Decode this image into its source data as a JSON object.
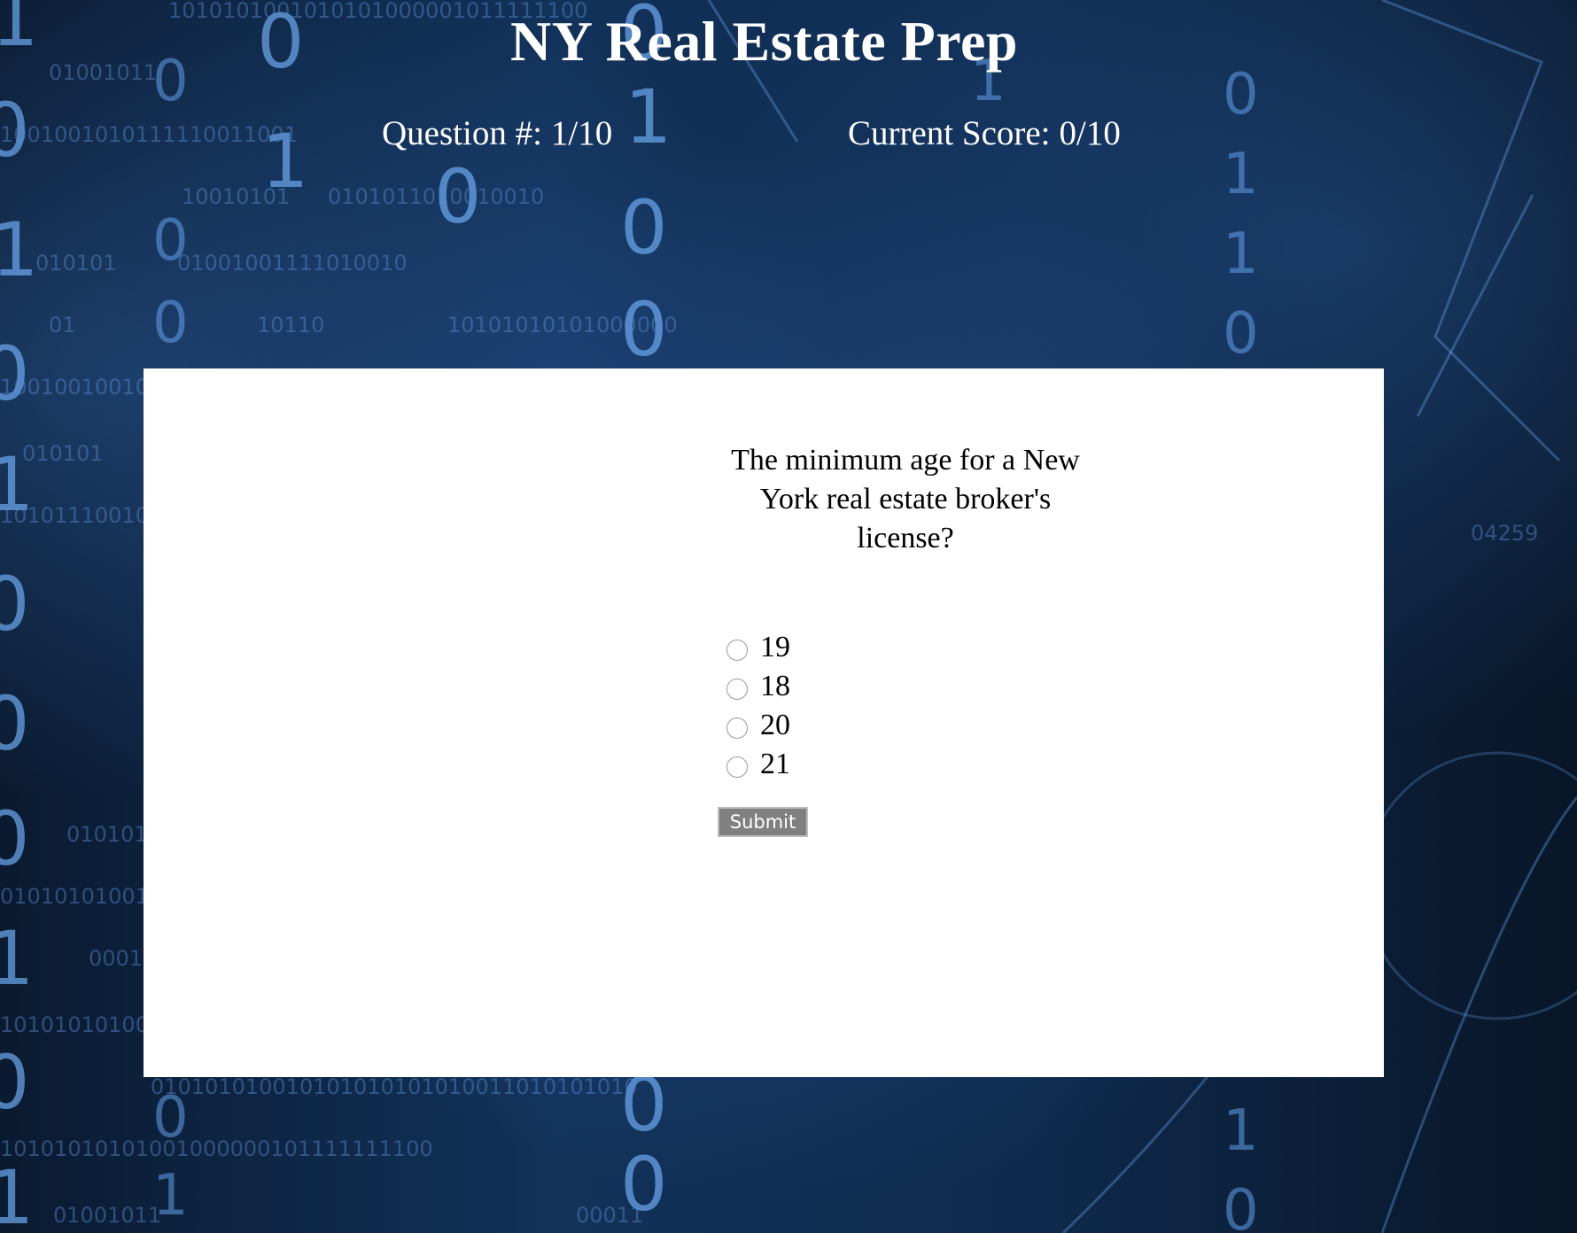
{
  "app": {
    "title": "NY Real Estate Prep"
  },
  "status": {
    "question_label": "Question #:",
    "question_value": "1/10",
    "score_label": "Current Score:",
    "score_value": "0/10"
  },
  "quiz": {
    "question": "The minimum age for a New York real estate broker's license?",
    "answers": [
      {
        "label": "19",
        "selected": false
      },
      {
        "label": "18",
        "selected": false
      },
      {
        "label": "20",
        "selected": false
      },
      {
        "label": "21",
        "selected": false
      }
    ],
    "submit_label": "Submit"
  },
  "colors": {
    "card_background": "#ffffff",
    "button_background": "#808080",
    "header_text": "#ffffff"
  }
}
